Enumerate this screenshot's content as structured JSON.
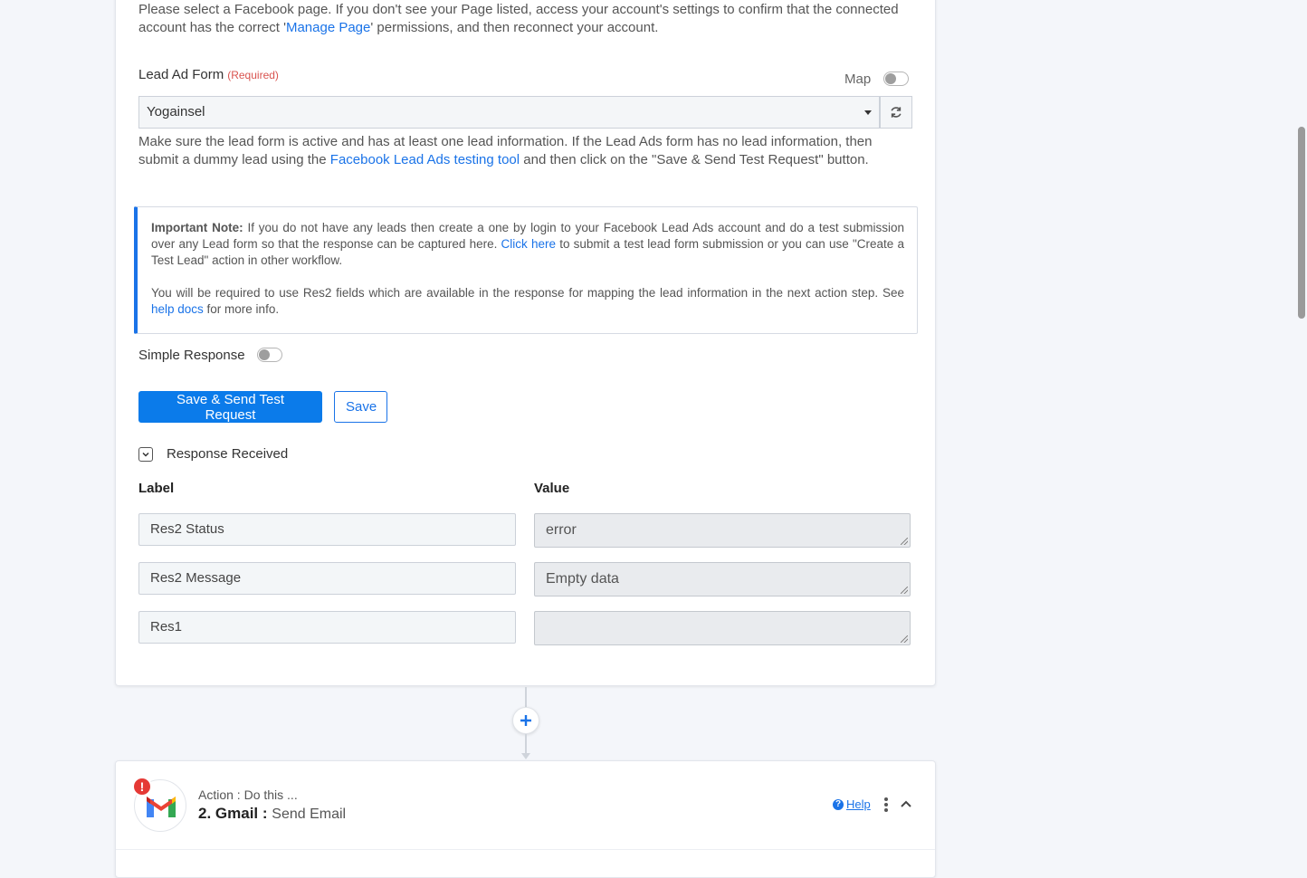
{
  "page_intro": {
    "text_before": "Please select a Facebook page. If you don't see your Page listed, access your account's settings to confirm that the connected account has the correct '",
    "link": "Manage Page",
    "text_after": "' permissions, and then reconnect your account."
  },
  "lead_form": {
    "label": "Lead Ad Form",
    "required": "(Required)",
    "map_label": "Map",
    "selected_value": "Yogainsel",
    "help_before": "Make sure the lead form is active and has at least one lead information. If the Lead Ads form has no lead information, then submit a dummy lead using the ",
    "help_link": "Facebook Lead Ads testing tool",
    "help_after": " and then click on the \"Save & Send Test Request\" button."
  },
  "note": {
    "title": "Important Note:",
    "p1_before": " If you do not have any leads then create a one by login to your Facebook Lead Ads account and do a test submission over any Lead form so that the response can be captured here. ",
    "p1_link": "Click here",
    "p1_after": " to submit a test lead form submission or you can use \"Create a Test Lead\" action in other workflow.",
    "p2_before": "You will be required to use Res2 fields which are available in the response for mapping the lead information in the next action step. See ",
    "p2_link": "help docs",
    "p2_after": " for more info."
  },
  "simple_response": {
    "label": "Simple Response"
  },
  "buttons": {
    "save_send": "Save & Send Test Request",
    "save": "Save"
  },
  "response": {
    "title": "Response Received",
    "col_label": "Label",
    "col_value": "Value",
    "rows": [
      {
        "label": "Res2 Status",
        "value": "error"
      },
      {
        "label": "Res2 Message",
        "value": "Empty data"
      },
      {
        "label": "Res1",
        "value": ""
      }
    ]
  },
  "action": {
    "subtitle": "Action : Do this ...",
    "step": "2. Gmail :",
    "service": "Send Email",
    "help": "Help",
    "alert": "!"
  },
  "colors": {
    "primary": "#0b7bea",
    "link": "#1a73e8",
    "required": "#d9534f",
    "alert": "#e53935"
  },
  "icons": [
    "refresh-icon",
    "caret-down-icon",
    "chevron-down-icon",
    "plus-icon",
    "gmail-logo-icon",
    "help-icon",
    "kebab-menu-icon",
    "chevron-up-icon"
  ]
}
